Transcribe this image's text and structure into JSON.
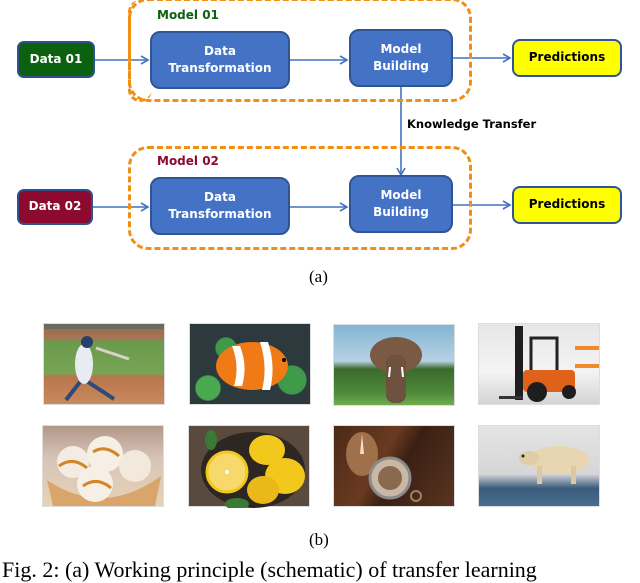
{
  "diagram": {
    "row1": {
      "group_label": "Model 01",
      "group_label_color": "#0b6110",
      "input": "Data 01",
      "input_color": "#0b6110",
      "transform": [
        "Data",
        "Transformation"
      ],
      "building": [
        "Model",
        "Building"
      ],
      "output": "Predictions"
    },
    "row2": {
      "group_label": "Model 02",
      "group_label_color": "#8b0a2e",
      "input": "Data 02",
      "input_color": "#8b0a2e",
      "transform": [
        "Data",
        "Transformation"
      ],
      "building": [
        "Model",
        "Building"
      ],
      "output": "Predictions"
    },
    "transfer_label": "Knowledge Transfer",
    "colors": {
      "process_fill": "#4472c4",
      "process_border": "#2f5597",
      "output_fill": "#ffff00",
      "dash_border": "#ef8f14",
      "arrow": "#4472c4"
    },
    "subcaption": "(a)"
  },
  "images": {
    "items": [
      {
        "subject": "baseball batter",
        "icon": "baseball-photo"
      },
      {
        "subject": "clownfish in anemone",
        "icon": "clownfish-photo"
      },
      {
        "subject": "elephant",
        "icon": "elephant-photo"
      },
      {
        "subject": "forklift in warehouse",
        "icon": "forklift-photo"
      },
      {
        "subject": "ice cream with caramel",
        "icon": "icecream-photo"
      },
      {
        "subject": "lemons in bowl",
        "icon": "lemons-photo"
      },
      {
        "subject": "compass on wood",
        "icon": "compass-photo"
      },
      {
        "subject": "polar bear",
        "icon": "polarbear-photo"
      }
    ],
    "subcaption": "(b)"
  },
  "caption": "Fig. 2: (a) Working principle (schematic) of transfer learning"
}
